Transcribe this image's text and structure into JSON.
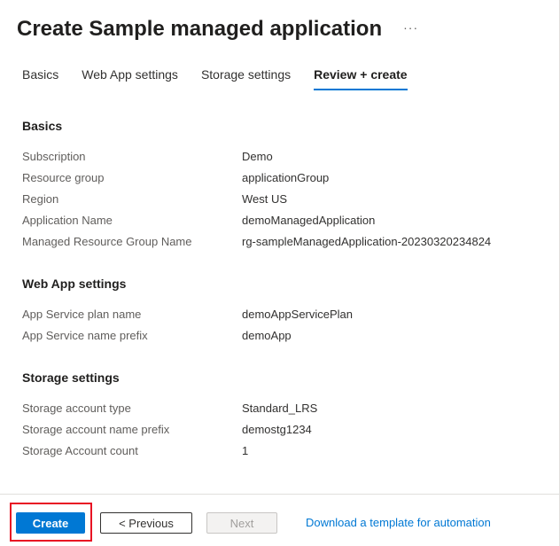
{
  "header": {
    "title": "Create Sample managed application",
    "more_label": "···"
  },
  "tabs": [
    {
      "label": "Basics",
      "active": false
    },
    {
      "label": "Web App settings",
      "active": false
    },
    {
      "label": "Storage settings",
      "active": false
    },
    {
      "label": "Review + create",
      "active": true
    }
  ],
  "sections": {
    "basics": {
      "title": "Basics",
      "rows": [
        {
          "label": "Subscription",
          "value": "Demo"
        },
        {
          "label": "Resource group",
          "value": "applicationGroup"
        },
        {
          "label": "Region",
          "value": "West US"
        },
        {
          "label": "Application Name",
          "value": "demoManagedApplication"
        },
        {
          "label": "Managed Resource Group Name",
          "value": "rg-sampleManagedApplication-20230320234824"
        }
      ]
    },
    "webapp": {
      "title": "Web App settings",
      "rows": [
        {
          "label": "App Service plan name",
          "value": "demoAppServicePlan"
        },
        {
          "label": "App Service name prefix",
          "value": "demoApp"
        }
      ]
    },
    "storage": {
      "title": "Storage settings",
      "rows": [
        {
          "label": "Storage account type",
          "value": "Standard_LRS"
        },
        {
          "label": "Storage account name prefix",
          "value": "demostg1234"
        },
        {
          "label": "Storage Account count",
          "value": "1"
        }
      ]
    }
  },
  "footer": {
    "create_label": "Create",
    "previous_label": "< Previous",
    "next_label": "Next",
    "download_label": "Download a template for automation"
  },
  "colors": {
    "accent": "#0078d4",
    "highlight": "#e81123"
  }
}
